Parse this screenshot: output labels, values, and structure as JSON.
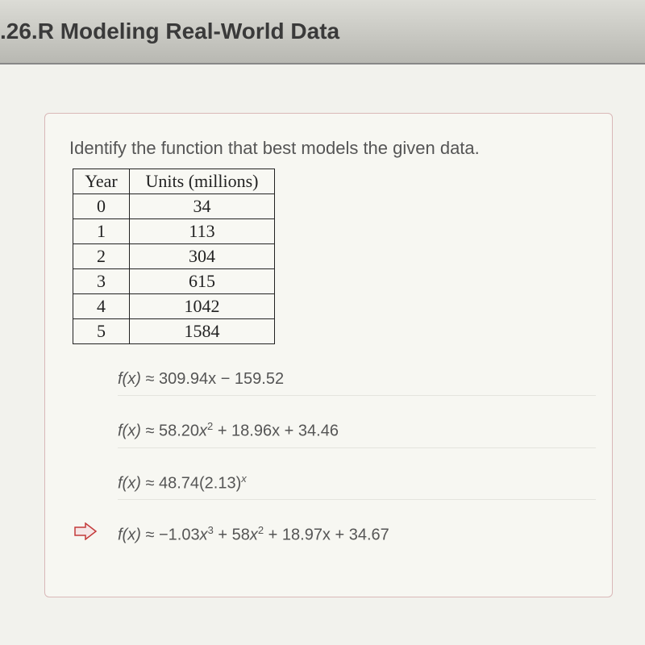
{
  "titlebar": {
    "text": ".26.R Modeling Real-World Data"
  },
  "question": {
    "prompt": "Identify the function that best models the given data."
  },
  "table": {
    "headers": {
      "col1": "Year",
      "col2": "Units (millions)"
    },
    "rows": [
      {
        "year": "0",
        "units": "34"
      },
      {
        "year": "1",
        "units": "113"
      },
      {
        "year": "2",
        "units": "304"
      },
      {
        "year": "3",
        "units": "615"
      },
      {
        "year": "4",
        "units": "1042"
      },
      {
        "year": "5",
        "units": "1584"
      }
    ]
  },
  "options": {
    "a": {
      "prefix": "f(x) ≈ ",
      "body": "309.94x − 159.52"
    },
    "b": {
      "prefix": "f(x) ≈ ",
      "coef1": "58.20",
      "term1": "x",
      "exp1": "2",
      "rest": " + 18.96x + 34.46"
    },
    "c": {
      "prefix": "f(x) ≈ ",
      "base": "48.74(2.13)",
      "exp": "x"
    },
    "d": {
      "prefix": "f(x) ≈ ",
      "coef1": "−1.03",
      "var1": "x",
      "exp1": "3",
      "mid1": " + 58",
      "var2": "x",
      "exp2": "2",
      "rest": " + 18.97x + 34.67"
    }
  },
  "selected_indicator": {
    "color": "#c43a3a"
  }
}
